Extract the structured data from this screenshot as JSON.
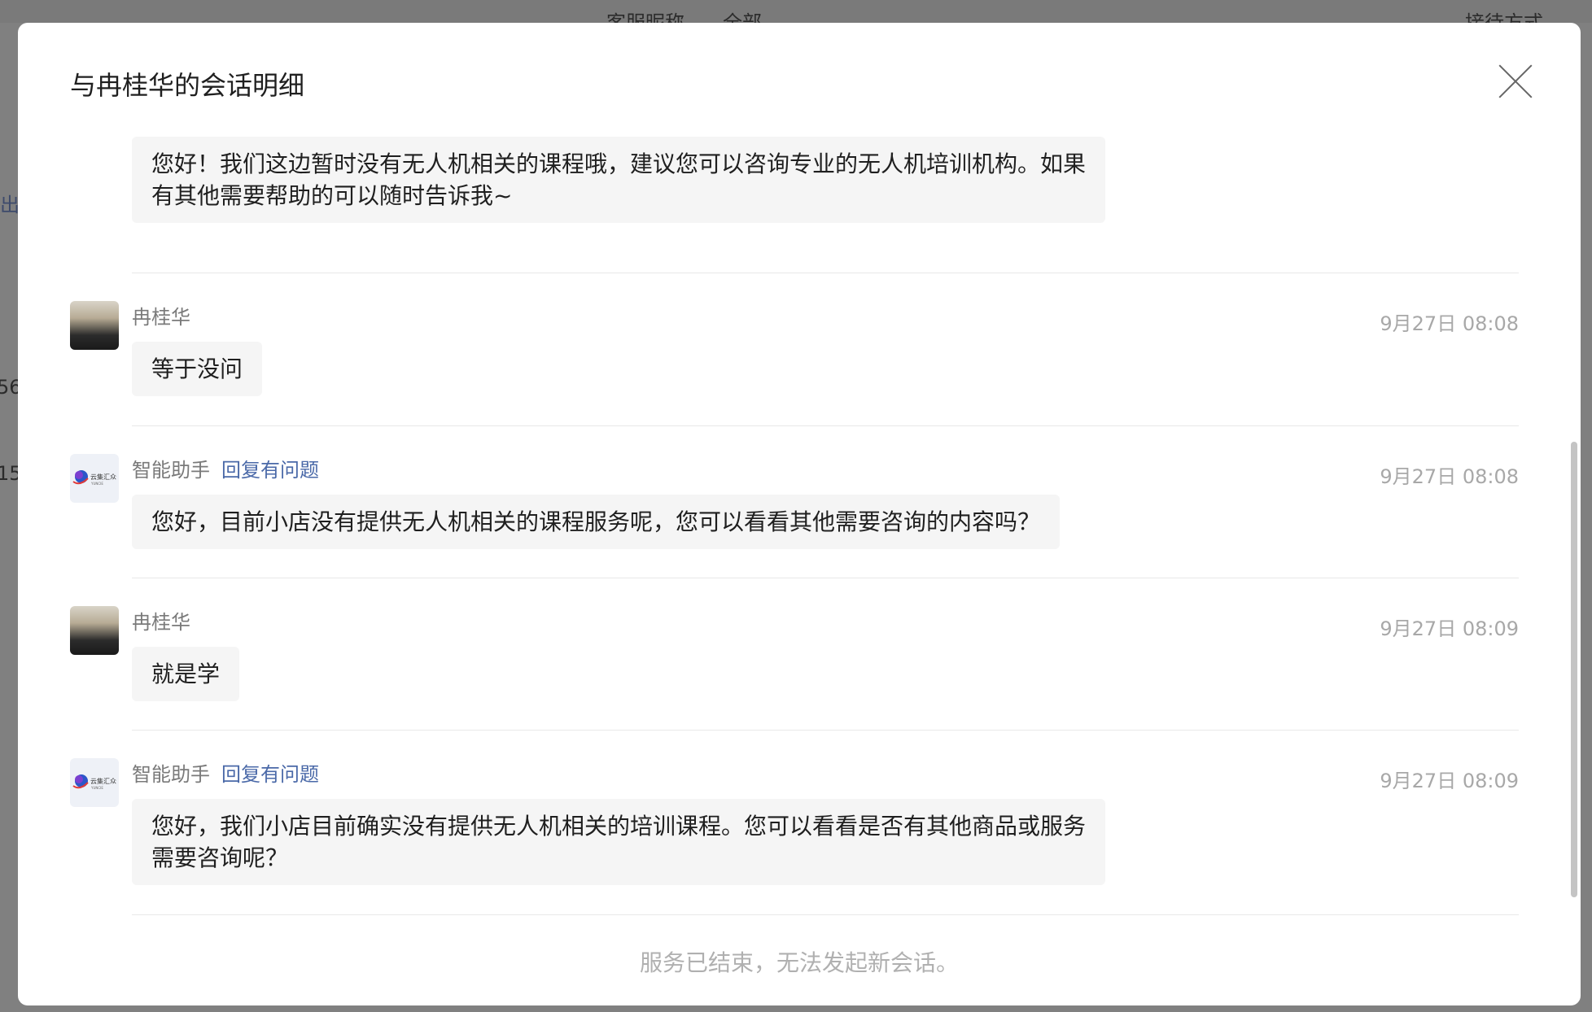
{
  "background": {
    "frag_top1": "客服昵称",
    "frag_top2": "全部",
    "frag_top3": "接待方式",
    "frag_left1": "导出",
    "frag_left2": "56",
    "frag_left3": "15"
  },
  "modal": {
    "title": "与冉桂华的会话明细",
    "footer_note": "服务已结束，无法发起新会话。"
  },
  "messages": [
    {
      "bubble": "您好！我们这边暂时没有无人机相关的课程哦，建议您可以咨询专业的无人机培训机构。如果有其他需要帮助的可以随时告诉我~"
    },
    {
      "sender": "冉桂华",
      "time": "9月27日 08:08",
      "bubble": "等于没问"
    },
    {
      "sender": "智能助手",
      "tag": "回复有问题",
      "time": "9月27日 08:08",
      "bubble": "您好，目前小店没有提供无人机相关的课程服务呢，您可以看看其他需要咨询的内容吗？"
    },
    {
      "sender": "冉桂华",
      "time": "9月27日 08:09",
      "bubble": "就是学"
    },
    {
      "sender": "智能助手",
      "tag": "回复有问题",
      "time": "9月27日 08:09",
      "bubble": "您好，我们小店目前确实没有提供无人机相关的培训课程。您可以看看是否有其他商品或服务需要咨询呢？"
    }
  ],
  "bot_logo": {
    "text1": "云集汇众",
    "text2": "YUNCIE"
  },
  "colors": {
    "tag_link": "#4a69a8",
    "bubble_bg": "#f5f5f5",
    "overlay": "#808080"
  },
  "icons": {
    "close": "close-icon"
  }
}
